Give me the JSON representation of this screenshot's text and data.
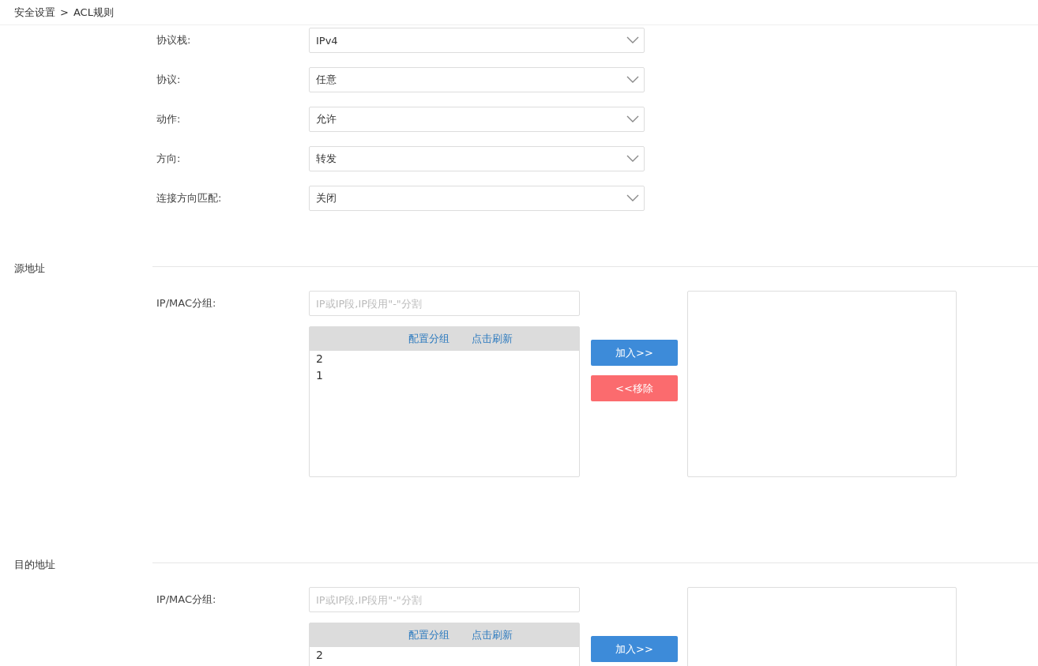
{
  "breadcrumb": {
    "parent": "安全设置",
    "separator": ">",
    "current": "ACL规则"
  },
  "fields": [
    {
      "label": "协议栈:",
      "value": "IPv4"
    },
    {
      "label": "协议:",
      "value": "任意"
    },
    {
      "label": "动作:",
      "value": "允许"
    },
    {
      "label": "方向:",
      "value": "转发"
    },
    {
      "label": "连接方向匹配:",
      "value": "关闭"
    }
  ],
  "sections": [
    {
      "title": "源地址",
      "group_label": "IP/MAC分组:",
      "placeholder": "IP或IP段,IP段用\"-\"分割",
      "links": [
        "配置分组",
        "点击刷新"
      ],
      "items": [
        "2",
        "1"
      ],
      "buttons": [
        {
          "kind": "add",
          "label": "加入>>"
        },
        {
          "kind": "remove",
          "label": "<<移除"
        }
      ]
    },
    {
      "title": "目的地址",
      "group_label": "IP/MAC分组:",
      "placeholder": "IP或IP段,IP段用\"-\"分割",
      "links": [
        "配置分组",
        "点击刷新"
      ],
      "items": [
        "2"
      ],
      "buttons": [
        {
          "kind": "add",
          "label": "加入>>"
        }
      ]
    }
  ]
}
